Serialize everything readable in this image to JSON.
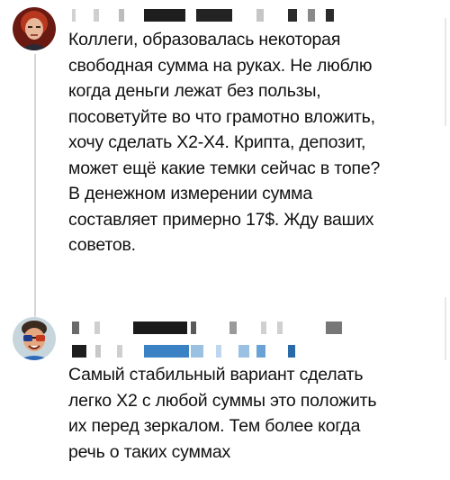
{
  "comments": [
    {
      "author_name": "",
      "author_redacted": true,
      "avatar": "user-avatar-red-hair",
      "text": "Коллеги, образовалась некоторая\nсвободная сумма на руках. Не люблю\nкогда деньги лежат без пользы,\nпосоветуйте во что грамотно вложить,\nхочу сделать Х2-Х4. Крипта, депозит,\nможет ещё какие темки сейчас в топе?\nВ денежном измерении сумма\nсоставляет примерно 17$. Жду ваших\nсоветов."
    },
    {
      "author_name": "",
      "author_redacted": true,
      "avatar": "user-avatar-sunglasses",
      "text": "Самый стабильный вариант сделать\nлегко Х2 с любой суммы это положить\nих перед зеркалом. Тем более когда\nречь о таких суммах"
    }
  ],
  "colors": {
    "text": "#111111",
    "thread_line": "#d7d7d7",
    "redacted_dark": "#1e1e1e",
    "redacted_light": "#cfcfcf",
    "redacted_blue": "#3b82c4"
  }
}
